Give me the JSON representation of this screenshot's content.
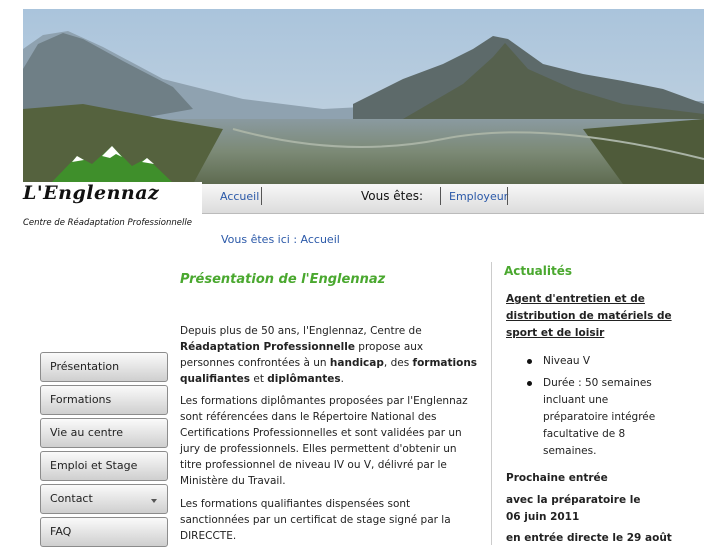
{
  "header": {
    "logo_title": "L'Englennaz",
    "logo_subtitle": "Centre de Réadaptation Professionnelle"
  },
  "nav": {
    "home_label": "Accueil",
    "you_are_label": "Vous êtes:",
    "audience_label": "Employeur"
  },
  "breadcrumb": "Vous êtes ici : Accueil",
  "sidebar": {
    "items": [
      {
        "label": "Présentation"
      },
      {
        "label": "Formations"
      },
      {
        "label": "Vie au centre"
      },
      {
        "label": "Emploi et Stage"
      },
      {
        "label": "Contact"
      },
      {
        "label": "FAQ"
      }
    ]
  },
  "main": {
    "title": "Présentation de l'Englennaz",
    "p1": {
      "t1": "Depuis plus de 50 ans, l'Englennaz, Centre de ",
      "b1": "Réadaptation Professionnelle",
      "t2": " propose aux personnes confrontées à un ",
      "b2": "handicap",
      "t3": ", des ",
      "b3": "formations qualifiantes",
      "t4": " et ",
      "b4": "diplômantes",
      "t5": "."
    },
    "p2": "Les formations diplômantes proposées par l'Englennaz sont référencées dans le Répertoire National des Certifications Professionnelles et sont validées par un jury de professionnels. Elles permettent d'obtenir un titre professionnel de niveau IV ou V, délivré par le Ministère du Travail.",
    "p3": "Les formations qualifiantes dispensées sont sanctionnées par un certificat de stage signé par la DIRECCTE."
  },
  "aside": {
    "title": "Actualités",
    "news_title": "Agent d'entretien et de distribution de matériels de sport et de loisir",
    "bullets": [
      "Niveau V",
      "Durée : 50 semaines incluant une préparatoire intégrée facultative de 8 semaines."
    ],
    "next_entry": "Prochaine entrée",
    "with_prep": "avec la préparatoire le 06 juin 2011",
    "direct_entry": "en entrée directe le 29 août"
  }
}
